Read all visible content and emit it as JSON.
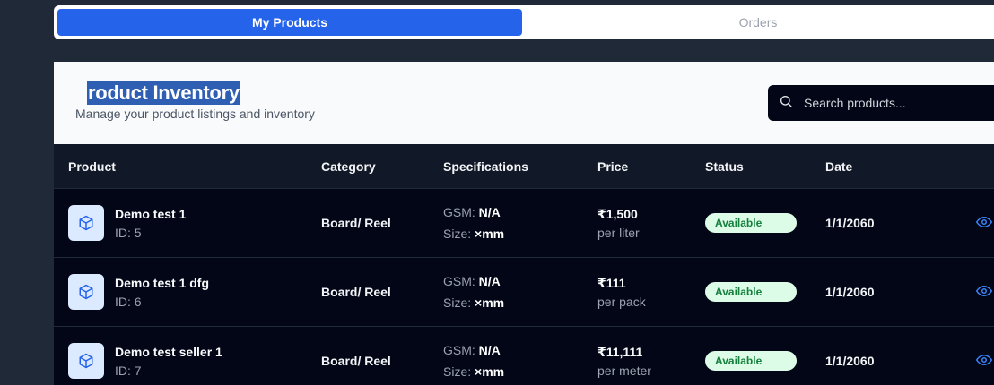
{
  "tabs": [
    {
      "label": "My Products",
      "active": true
    },
    {
      "label": "Orders",
      "active": false
    }
  ],
  "header": {
    "title": "roduct Inventory",
    "subtitle": "Manage your product listings and inventory"
  },
  "search": {
    "placeholder": "Search products..."
  },
  "table": {
    "columns": [
      "Product",
      "Category",
      "Specifications",
      "Price",
      "Status",
      "Date"
    ],
    "rows": [
      {
        "name": "Demo test 1",
        "id": "ID: 5",
        "category": "Board/ Reel",
        "gsm_label": "GSM:",
        "gsm": "N/A",
        "size_label": "Size:",
        "size": "×mm",
        "price": "₹1,500",
        "unit": "per liter",
        "status": "Available",
        "date": "1/1/2060"
      },
      {
        "name": "Demo test 1 dfg",
        "id": "ID: 6",
        "category": "Board/ Reel",
        "gsm_label": "GSM:",
        "gsm": "N/A",
        "size_label": "Size:",
        "size": "×mm",
        "price": "₹111",
        "unit": "per pack",
        "status": "Available",
        "date": "1/1/2060"
      },
      {
        "name": "Demo test seller 1",
        "id": "ID: 7",
        "category": "Board/ Reel",
        "gsm_label": "GSM:",
        "gsm": "N/A",
        "size_label": "Size:",
        "size": "×mm",
        "price": "₹11,111",
        "unit": "per meter",
        "status": "Available",
        "date": "1/1/2060"
      }
    ]
  },
  "icons": {
    "search": "search-icon",
    "product": "box-icon",
    "view": "eye-icon"
  },
  "colors": {
    "accent": "#2563eb",
    "status_bg": "#dcfce7",
    "status_text": "#15803d"
  }
}
